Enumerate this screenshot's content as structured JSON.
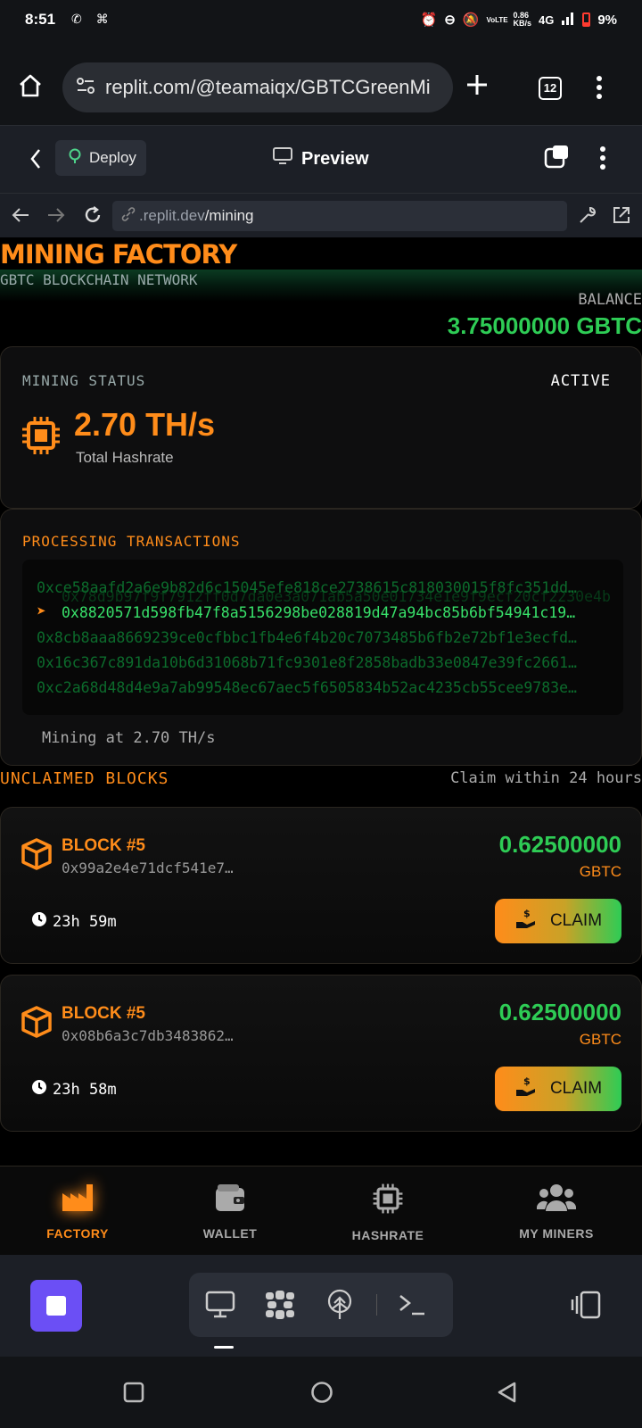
{
  "status_bar": {
    "time": "8:51",
    "battery": "9%",
    "network": "4G",
    "speed": "0.86",
    "speed_unit": "KB/s",
    "volte": "VoLTE"
  },
  "browser": {
    "url": "replit.com/@teamaiqx/GBTCGreenMi",
    "tab_count": "12"
  },
  "replit_header": {
    "deploy_label": "Deploy",
    "preview_label": "Preview"
  },
  "dev_bar": {
    "url_prefix": ".replit.dev",
    "url_path": "/mining"
  },
  "app": {
    "title": "MINING FACTORY",
    "network": "GBTC BLOCKCHAIN NETWORK",
    "balance_label": "BALANCE",
    "balance_value": "3.75000000 GBTC",
    "mining_status_label": "MINING STATUS",
    "mining_status_value": "ACTIVE",
    "hashrate": "2.70 TH/s",
    "hashrate_label": "Total Hashrate",
    "tx_title": "PROCESSING TRANSACTIONS",
    "transactions": [
      "0xce58aafd2a6e9b82d6c15045efe818ce2738615c818030015f8fc351dd…",
      "0x8820571d598fb47f8a5156298be028819d47a94bc85b6bf54941c19…",
      "0x8cb8aaa8669239ce0cfbbc1fb4e6f4b20c7073485b6fb2e72bf1e3ecfd…",
      "0x16c367c891da10b6d31068b71fc9301e8f2858badb33e0847e39fc2661…",
      "0xc2a68d48d4e9a7ab99548ec67aec5f6505834b52ac4235cb55cee9783e…"
    ],
    "tx_ghost": "0x78d9b97f9f7912ff0d7da0e3a071ab5a50e01734e1e9f9ecf20cf2230e4b",
    "mining_at": "Mining at 2.70 TH/s",
    "unclaimed_title": "UNCLAIMED BLOCKS",
    "unclaimed_hint": "Claim within 24 hours",
    "blocks": [
      {
        "title": "BLOCK #5",
        "hash": "0x99a2e4e71dcf541e7…",
        "amount": "0.62500000",
        "unit": "GBTC",
        "timer": "23h 59m",
        "claim_label": "CLAIM"
      },
      {
        "title": "BLOCK #5",
        "hash": "0x08b6a3c7db3483862…",
        "amount": "0.62500000",
        "unit": "GBTC",
        "timer": "23h 58m",
        "claim_label": "CLAIM"
      }
    ]
  },
  "bottom_nav": {
    "items": [
      {
        "label": "FACTORY",
        "icon": "factory-icon",
        "active": true
      },
      {
        "label": "WALLET",
        "icon": "wallet-icon",
        "active": false
      },
      {
        "label": "HASHRATE",
        "icon": "chip-icon",
        "active": false
      },
      {
        "label": "MY MINERS",
        "icon": "users-icon",
        "active": false
      }
    ]
  },
  "colors": {
    "accent_orange": "#ff8c1a",
    "accent_green": "#2ecc55",
    "stop_purple": "#6b4ff5"
  }
}
